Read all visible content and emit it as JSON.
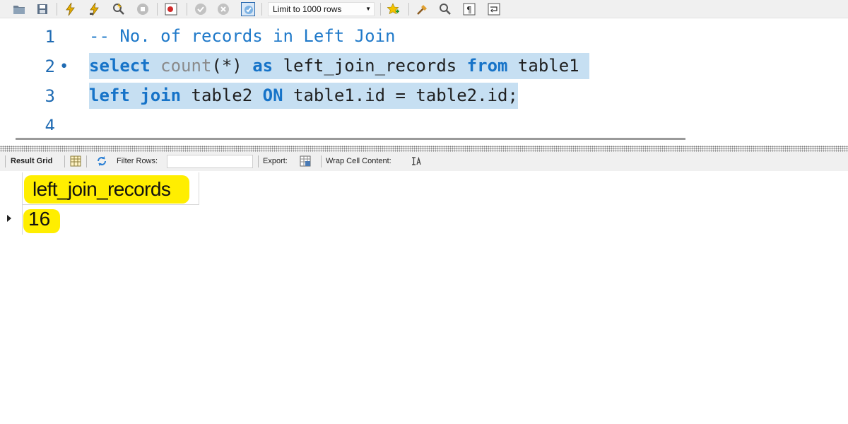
{
  "toolbar": {
    "icons": [
      "open-folder-icon",
      "save-icon",
      "execute-icon",
      "execute-current-icon",
      "explain-icon",
      "stop-icon",
      "toggle-errors-icon",
      "commit-icon",
      "rollback-icon",
      "autocommit-icon",
      "beautify-icon",
      "find-icon",
      "invisible-chars-icon",
      "wrap-icon",
      "bookmark-icon"
    ],
    "limit_label": "Limit to 1000 rows"
  },
  "editor": {
    "lines": [
      {
        "number": "1",
        "marker": ""
      },
      {
        "number": "2",
        "marker": "•"
      },
      {
        "number": "3",
        "marker": ""
      },
      {
        "number": "4",
        "marker": ""
      }
    ],
    "line1": {
      "comment": "-- No. of records in Left Join"
    },
    "line2": {
      "kw_select": "select",
      "fn_count": "count",
      "paren": "(*)",
      "kw_as": "as",
      "alias": "left_join_records",
      "kw_from": "from",
      "table": "table1"
    },
    "line3": {
      "kw_left": "left",
      "kw_join": "join",
      "table": "table2",
      "kw_on": "ON",
      "condition": "table1.id = table2.id;"
    }
  },
  "result_toolbar": {
    "result_grid_label": "Result Grid",
    "filter_label": "Filter Rows:",
    "filter_value": "",
    "export_label": "Export:",
    "wrap_label": "Wrap Cell Content:"
  },
  "result_grid": {
    "columns": [
      "left_join_records"
    ],
    "rows": [
      [
        "16"
      ]
    ]
  },
  "colors": {
    "selection": "#c6dff2",
    "keyword": "#1673c8",
    "highlight": "#ffee00"
  }
}
